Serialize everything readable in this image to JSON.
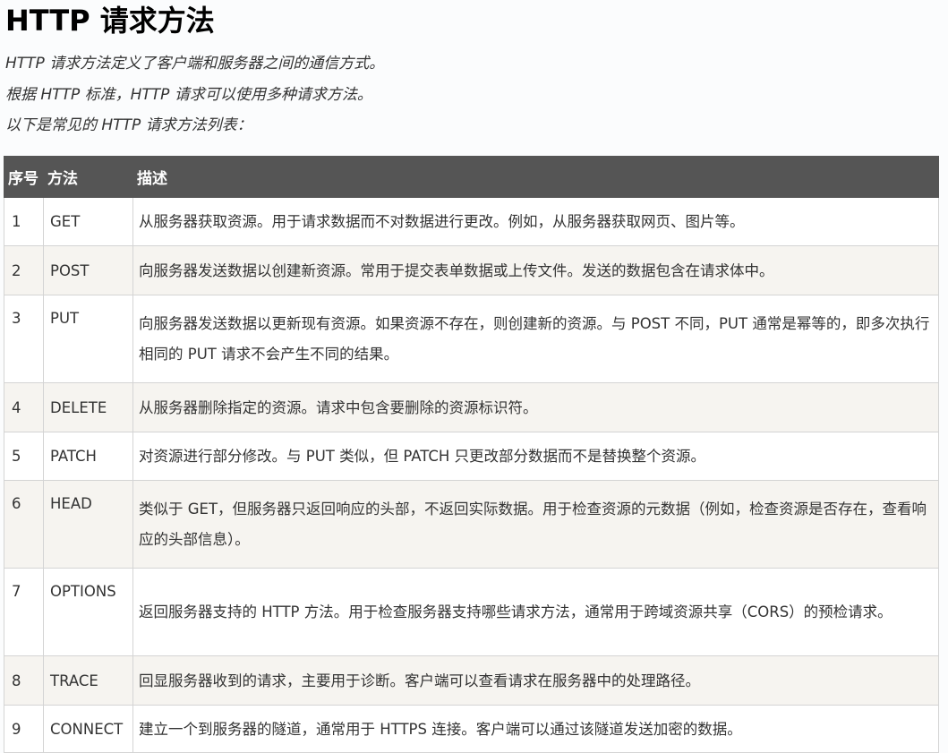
{
  "title": "HTTP 请求方法",
  "intro": [
    "HTTP 请求方法定义了客户端和服务器之间的通信方式。",
    "根据 HTTP 标准，HTTP 请求可以使用多种请求方法。",
    "以下是常见的 HTTP 请求方法列表："
  ],
  "table": {
    "headers": [
      "序号",
      "方法",
      "描述"
    ],
    "rows": [
      {
        "index": "1",
        "method": "GET",
        "description": "从服务器获取资源。用于请求数据而不对数据进行更改。例如，从服务器获取网页、图片等。"
      },
      {
        "index": "2",
        "method": "POST",
        "description": "向服务器发送数据以创建新资源。常用于提交表单数据或上传文件。发送的数据包含在请求体中。"
      },
      {
        "index": "3",
        "method": "PUT",
        "description": "向服务器发送数据以更新现有资源。如果资源不存在，则创建新的资源。与 POST 不同，PUT 通常是幂等的，即多次执行相同的 PUT 请求不会产生不同的结果。"
      },
      {
        "index": "4",
        "method": "DELETE",
        "description": "从服务器删除指定的资源。请求中包含要删除的资源标识符。"
      },
      {
        "index": "5",
        "method": "PATCH",
        "description": "对资源进行部分修改。与 PUT 类似，但 PATCH 只更改部分数据而不是替换整个资源。"
      },
      {
        "index": "6",
        "method": "HEAD",
        "description": "类似于 GET，但服务器只返回响应的头部，不返回实际数据。用于检查资源的元数据（例如，检查资源是否存在，查看响应的头部信息）。"
      },
      {
        "index": "7",
        "method": "OPTIONS",
        "description": "返回服务器支持的 HTTP 方法。用于检查服务器支持哪些请求方法，通常用于跨域资源共享（CORS）的预检请求。"
      },
      {
        "index": "8",
        "method": "TRACE",
        "description": "回显服务器收到的请求，主要用于诊断。客户端可以查看请求在服务器中的处理路径。"
      },
      {
        "index": "9",
        "method": "CONNECT",
        "description": "建立一个到服务器的隧道，通常用于 HTTPS 连接。客户端可以通过该隧道发送加密的数据。"
      }
    ]
  },
  "colors": {
    "header_bg": "#555555",
    "header_text": "#ffffff",
    "row_alt_bg": "#f6f4f0",
    "row_bg": "#ffffff",
    "border": "#d4d4d4",
    "text": "#333333"
  }
}
